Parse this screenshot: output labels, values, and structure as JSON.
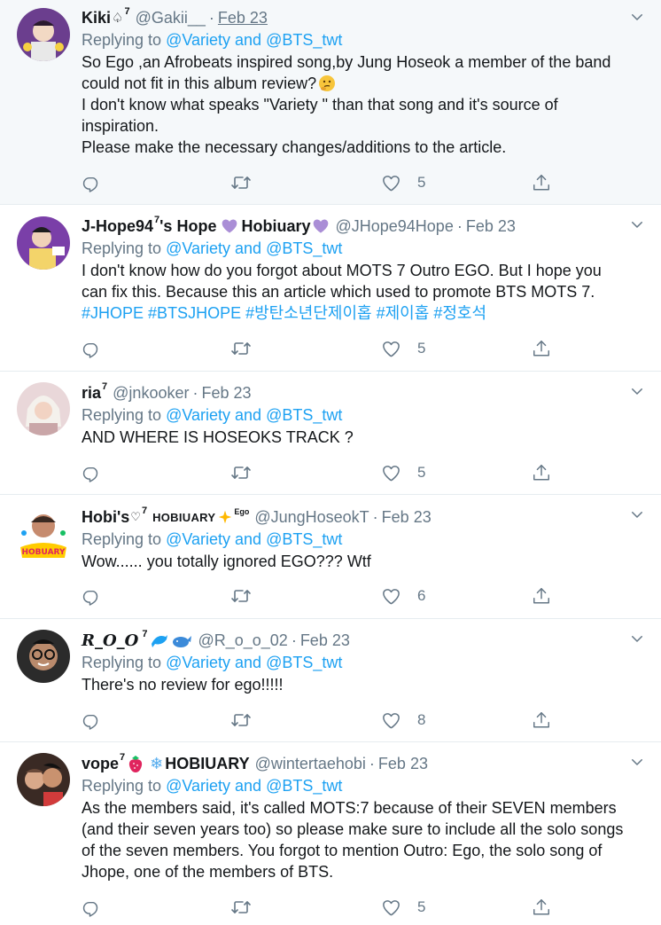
{
  "replying_label": "Replying to",
  "reply_targets": "@Variety and @BTS_twt",
  "tweets": [
    {
      "name": "Kiki",
      "sup": "7",
      "handle": "@Gakii__",
      "date": "Feb 23",
      "lines": [
        "So Ego ,an Afrobeats inspired song,by Jung Hoseok a member of the band",
        "could not fit in this album review?",
        "I don't know what speaks \"Variety \" than that song and it's source of",
        "inspiration.",
        "Please make the necessary changes/additions to the article."
      ],
      "likes": "5"
    },
    {
      "name": "J-Hope94",
      "sup": "7",
      "name_suffix": "'s Hope",
      "name_suffix2": "Hobiuary",
      "handle": "@JHope94Hope",
      "date": "Feb 23",
      "lines": [
        "I don't know how do you forgot about MOTS 7 Outro EGO. But I hope you",
        "can fix this. Because this an article which used to promote BTS MOTS 7."
      ],
      "hashtags": [
        "#JHOPE",
        "#BTSJHOPE",
        "#방탄소년단제이홉",
        "#제이홉",
        "#정호석"
      ],
      "likes": "5"
    },
    {
      "name": "ria",
      "sup": "7",
      "handle": "@jnkooker",
      "date": "Feb 23",
      "lines": [
        "AND WHERE IS HOSEOKS TRACK ?"
      ],
      "likes": "5"
    },
    {
      "name": "Hobi's",
      "sup": "7",
      "name_suffix": "HOBIUARY",
      "name_tiny": "Ego",
      "handle": "@JungHoseokT",
      "date": "Feb 23",
      "lines": [
        "Wow...... you totally ignored EGO??? Wtf"
      ],
      "likes": "6"
    },
    {
      "name": "R_O_O",
      "sup": "7",
      "handle": "@R_o_o_02",
      "date": "Feb 23",
      "lines": [
        "There's no review for ego!!!!!"
      ],
      "likes": "8"
    },
    {
      "name": "vope",
      "sup": "7",
      "name_suffix": "HOBIUARY",
      "handle": "@wintertaehobi",
      "date": "Feb 23",
      "lines": [
        "As the members said, it's called MOTS:7 because of their SEVEN members",
        "(and their seven years too) so please make sure to include all the solo songs",
        "of the seven members. You forgot to mention Outro: Ego, the solo song of",
        "Jhope, one of the members of BTS."
      ],
      "likes": "5"
    }
  ],
  "icons": [
    "reply-icon",
    "retweet-icon",
    "like-icon",
    "share-icon",
    "chevron-down-icon"
  ],
  "colors": {
    "link": "#1da1f2",
    "muted": "#657786",
    "text": "#14171a",
    "highlight_bg": "#f5f8fa",
    "border": "#e6ecf0"
  }
}
